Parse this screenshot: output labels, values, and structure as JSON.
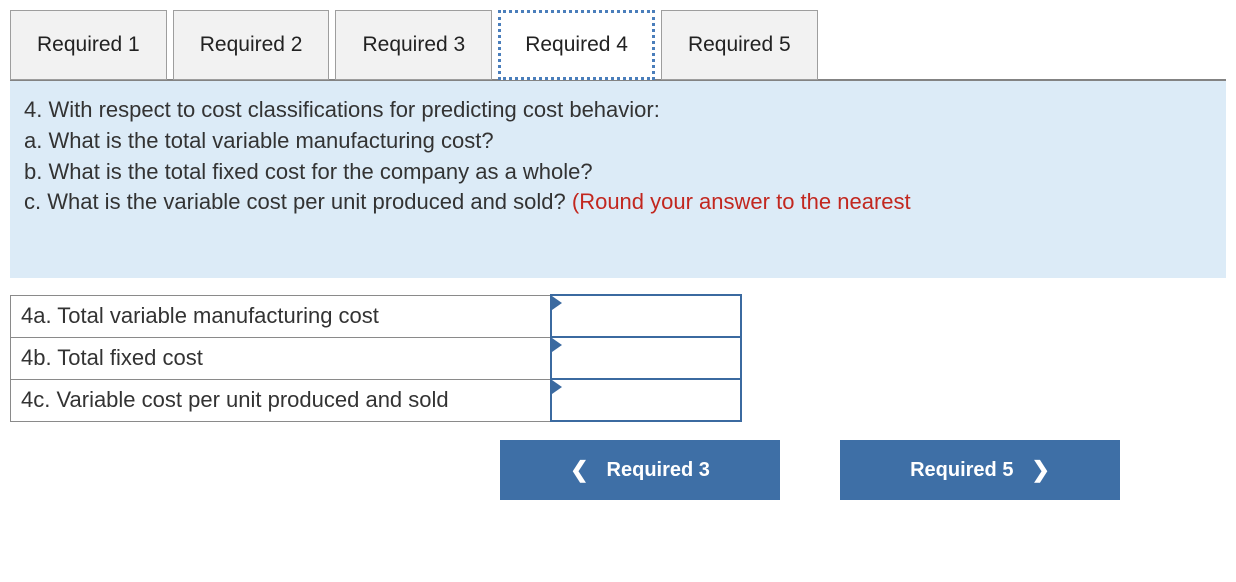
{
  "tabs": [
    {
      "label": "Required 1",
      "active": false
    },
    {
      "label": "Required 2",
      "active": false
    },
    {
      "label": "Required 3",
      "active": false
    },
    {
      "label": "Required 4",
      "active": true
    },
    {
      "label": "Required 5",
      "active": false
    }
  ],
  "question": {
    "intro": "4. With respect to cost classifications for predicting cost behavior:",
    "a": "a. What is the total variable manufacturing cost?",
    "b": "b. What is the total fixed cost for the company as a whole?",
    "c_prefix": "c. What is the variable cost per unit produced and sold? ",
    "c_hint": "(Round your answer to the nearest"
  },
  "rows": [
    {
      "label": "4a. Total variable manufacturing cost",
      "value": ""
    },
    {
      "label": "4b. Total fixed cost",
      "value": ""
    },
    {
      "label": "4c. Variable cost per unit produced and sold",
      "value": ""
    }
  ],
  "nav": {
    "prev_label": "Required 3",
    "next_label": "Required 5"
  }
}
